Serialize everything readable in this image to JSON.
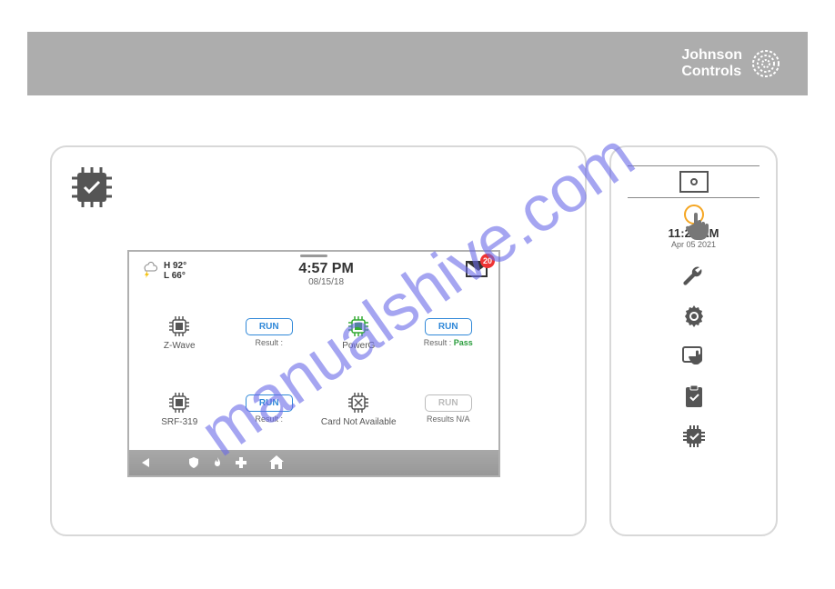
{
  "header": {
    "brand_line1": "Johnson",
    "brand_line2": "Controls"
  },
  "watermark": "manualshive.com",
  "device": {
    "weather": {
      "high": "H 92°",
      "low": "L 66°"
    },
    "time": "4:57 PM",
    "date": "08/15/18",
    "mail_count": "20",
    "tests": {
      "zwave": {
        "label": "Z-Wave",
        "run": "RUN",
        "result_label": "Result :"
      },
      "powerg": {
        "label": "PowerG",
        "run": "RUN",
        "result_label": "Result :",
        "result_value": "Pass"
      },
      "srf319": {
        "label": "SRF-319",
        "run": "RUN",
        "result_label": "Result :"
      },
      "card": {
        "label": "Card Not Available",
        "run": "RUN",
        "result_label": "Results N/A"
      }
    }
  },
  "right": {
    "time": "11:23 AM",
    "date": "Apr 05 2021"
  }
}
